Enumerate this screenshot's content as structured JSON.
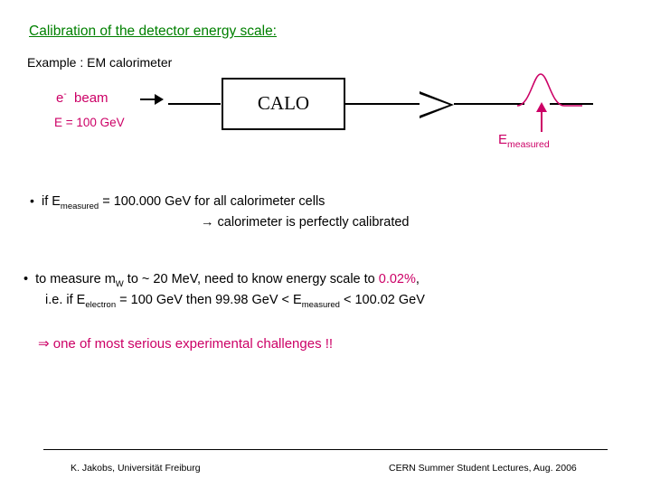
{
  "slide": {
    "title": "Calibration of the detector energy scale:",
    "example_line": "Example : EM calorimeter",
    "diagram": {
      "beam_label_prefix": "e",
      "beam_label_sup": "-",
      "beam_label_suffix": "beam",
      "energy_label": "E = 100 GeV",
      "calo_box_label": "CALO",
      "measured_label_base": "E",
      "measured_label_sub": "measured"
    },
    "bullets": {
      "b1_dot": "•",
      "b1_text_pre": "if  E",
      "b1_sub": "measured",
      "b1_text_post": " = 100.000 GeV for all calorimeter cells",
      "b1_arrow": "→",
      "b1_conclusion": " calorimeter is perfectly calibrated",
      "b2_dot": "•",
      "b2_pre": "to measure m",
      "b2_sub": "W",
      "b2_post": " to ~ 20 MeV, need to know energy scale to ",
      "b2_highlight": "0.02%",
      "b2_tail": ",",
      "b2b_pre": "i.e.  if  E",
      "b2b_sub": "electron",
      "b2b_mid": " = 100 GeV then  99.98 GeV < E",
      "b2b_sub2": "measured",
      "b2b_post": " < 100.02 GeV",
      "b3_arrow": "⇒",
      "b3_text": " one of most serious experimental challenges !!"
    },
    "footer": {
      "left": "K. Jakobs, Universität Freiburg",
      "right": "CERN Summer Student Lectures, Aug. 2006"
    },
    "colors": {
      "title_green": "#008000",
      "magenta": "#cc0066",
      "black": "#000000"
    }
  }
}
